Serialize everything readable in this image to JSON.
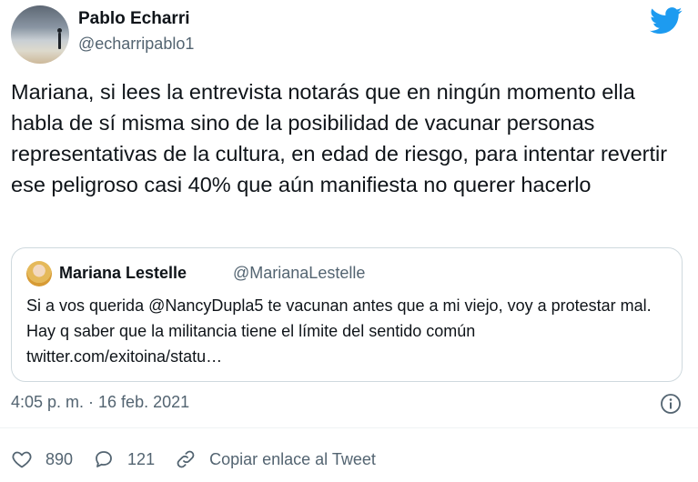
{
  "author": {
    "name": "Pablo Echarri",
    "handle": "@echarripablo1",
    "avatar": "avatar-photo"
  },
  "brand": {
    "icon": "twitter-bird-icon",
    "color": "#1d9bf0"
  },
  "tweet": {
    "text": "Mariana, si lees la entrevista notarás que en ningún momento ella habla de sí misma sino de la posibilidad de vacunar personas representativas de la cultura, en edad de riesgo, para intentar revertir ese peligroso casi 40% que aún manifiesta no querer hacerlo"
  },
  "quote": {
    "name": "Mariana Lestelle",
    "handle": "@MarianaLestelle",
    "text": "Si a vos querida @NancyDupla5 te vacunan antes que a mi viejo, voy a protestar mal. Hay q saber que la militancia tiene el límite del sentido común twitter.com/exitoina/statu…"
  },
  "meta": {
    "timestamp": "4:05 p. m. · 16 feb. 2021",
    "info_icon": "info-icon"
  },
  "actions": {
    "likes": "890",
    "replies": "121",
    "copy_link": "Copiar enlace al Tweet"
  }
}
